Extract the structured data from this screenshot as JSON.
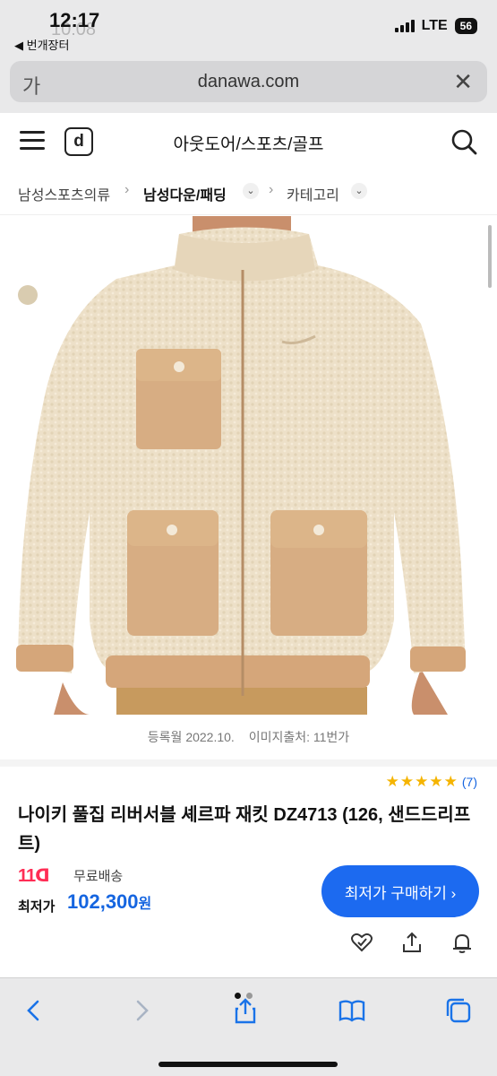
{
  "status_bar": {
    "time": "12:17",
    "time_ghost": "10:08",
    "back_label": "◀ 번개장터",
    "network": "LTE",
    "battery": "56"
  },
  "browser": {
    "url_left_glyph": "가",
    "url": "danawa.com"
  },
  "header": {
    "logo_letter": "d",
    "title": "아웃도어/스포츠/골프"
  },
  "breadcrumb": {
    "level1": "남성스포츠의류",
    "level2": "남성다운/패딩",
    "level3": "카테고리"
  },
  "image_meta": {
    "registered": "등록월 2022.10.",
    "source": "이미지출처: 11번가"
  },
  "product": {
    "stars": "★★★★★",
    "review_count": "(7)",
    "name": "나이키 풀집 리버서블 셰르파 재킷 DZ4713 (126, 샌드드리프트)",
    "seller_logo": "11ᗡ",
    "shipping": "무료배송",
    "price_label": "최저가",
    "price": "102,300",
    "price_unit": "원",
    "buy_button": "최저가 구매하기 ›"
  },
  "colors": {
    "accent": "#1c6af0",
    "price": "#1565e0",
    "star": "#f5b400",
    "swatch": "#d9ccb0"
  }
}
